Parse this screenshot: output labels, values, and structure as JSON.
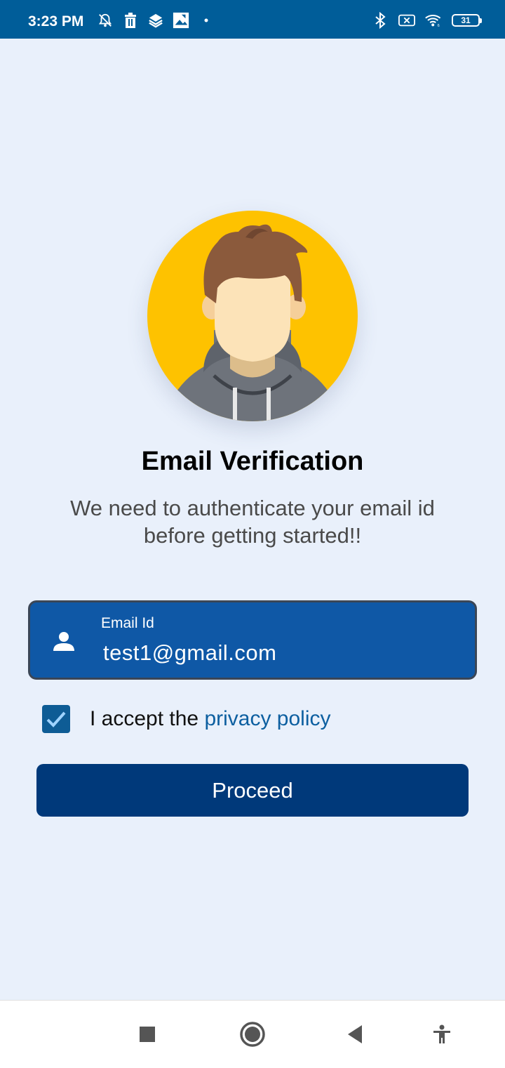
{
  "status_bar": {
    "time": "3:23 PM",
    "battery_level": "31",
    "left_icons": [
      "alarm-off-icon",
      "trash-icon",
      "layers-icon",
      "gallery-icon",
      "dot-icon"
    ],
    "right_icons": [
      "bluetooth-icon",
      "sim-off-icon",
      "wifi-icon",
      "battery-icon"
    ]
  },
  "avatar": {
    "icon": "user-avatar-illustration",
    "bg_color": "#fec200"
  },
  "header": {
    "title": "Email Verification",
    "subtitle": "We need to authenticate your email id before getting started!!"
  },
  "email_field": {
    "label": "Email Id",
    "value": "test1@gmail.com",
    "icon": "person-icon",
    "bg_color": "#0f58a6"
  },
  "consent": {
    "checked": true,
    "text": "I accept the ",
    "link_text": "privacy policy"
  },
  "proceed_button": {
    "label": "Proceed",
    "color": "#00397a"
  },
  "nav_bar": {
    "buttons": [
      "recents-icon",
      "home-icon",
      "back-icon",
      "accessibility-icon"
    ]
  },
  "colors": {
    "background": "#e9f0fb",
    "status_bar": "#005d99",
    "link": "#0d5fa0"
  }
}
